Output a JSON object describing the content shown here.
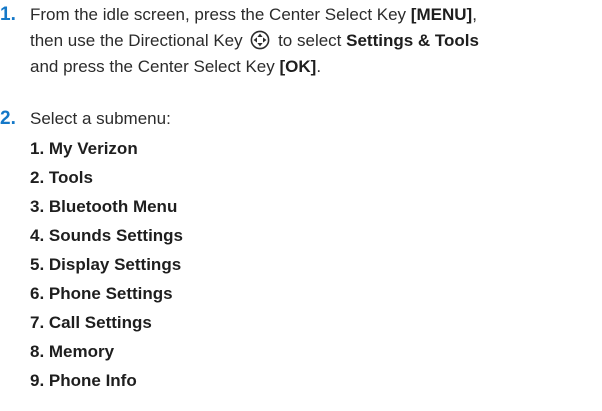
{
  "step1": {
    "number": "1.",
    "line1_text": "From the idle screen, press the Center Select Key ",
    "line1_key": "[MENU]",
    "line1_end": ",",
    "line2_text_a": "then use the Directional Key ",
    "line2_text_b": " to select ",
    "line2_bold": "Settings & Tools",
    "line3_text": "and press the Center Select Key ",
    "line3_key": "[OK]",
    "line3_end": "."
  },
  "step2": {
    "number": "2.",
    "text": "Select a submenu:",
    "items": [
      "1. My Verizon",
      "2. Tools",
      "3. Bluetooth Menu",
      "4. Sounds Settings",
      "5. Display Settings",
      "6. Phone Settings",
      "7. Call Settings",
      "8. Memory",
      "9. Phone Info"
    ]
  },
  "colors": {
    "step_number": "#1478c8",
    "text": "#2b2b2b"
  },
  "icons": {
    "directional_key": "directional-key-icon"
  }
}
